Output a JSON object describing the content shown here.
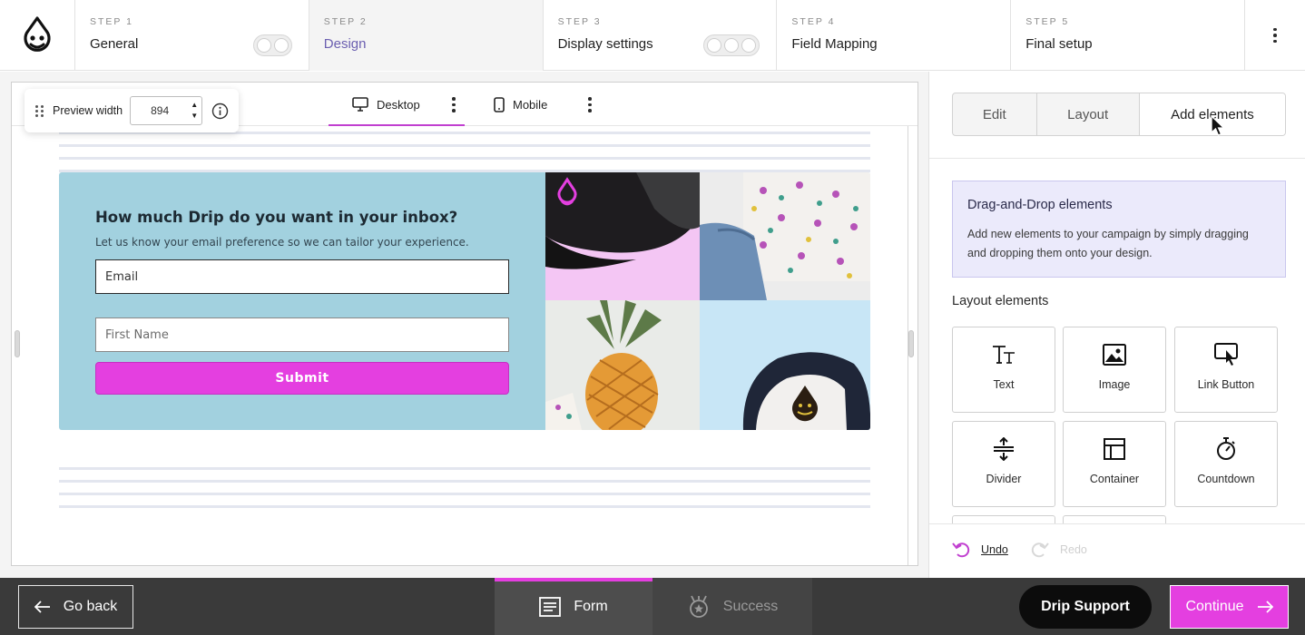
{
  "steps": [
    {
      "num": "STEP 1",
      "title": "General"
    },
    {
      "num": "STEP 2",
      "title": "Design"
    },
    {
      "num": "STEP 3",
      "title": "Display settings"
    },
    {
      "num": "STEP 4",
      "title": "Field Mapping"
    },
    {
      "num": "STEP 5",
      "title": "Final setup"
    }
  ],
  "preview": {
    "width_label": "Preview width",
    "width_value": "894",
    "tabs": [
      "Desktop",
      "Mobile"
    ],
    "active_tab": "Desktop"
  },
  "form": {
    "title": "How much Drip do you want in your inbox?",
    "subtitle": "Let us know your email preference so we can tailor your experience.",
    "email_value": "Email",
    "first_name_placeholder": "First Name",
    "submit_label": "Submit"
  },
  "panel": {
    "tabs": [
      "Edit",
      "Layout",
      "Add elements"
    ],
    "active_tab": "Add elements",
    "dnd_title": "Drag-and-Drop elements",
    "dnd_desc": "Add new elements to your campaign by simply dragging and dropping them onto your design.",
    "layout_heading": "Layout elements",
    "elements": [
      {
        "label": "Text",
        "icon": "text-icon"
      },
      {
        "label": "Image",
        "icon": "image-icon"
      },
      {
        "label": "Link Button",
        "icon": "link-button-icon"
      },
      {
        "label": "Divider",
        "icon": "divider-icon"
      },
      {
        "label": "Container",
        "icon": "container-icon"
      },
      {
        "label": "Countdown",
        "icon": "countdown-icon"
      }
    ],
    "undo_label": "Undo",
    "redo_label": "Redo"
  },
  "bottom": {
    "go_back": "Go back",
    "form_tab": "Form",
    "success_tab": "Success",
    "support": "Drip Support",
    "continue": "Continue"
  },
  "colors": {
    "accent": "#e43fe0",
    "active_step_text": "#6b5fb0",
    "form_bg": "#a2d1df",
    "dnd_bg": "#ebeafb"
  }
}
